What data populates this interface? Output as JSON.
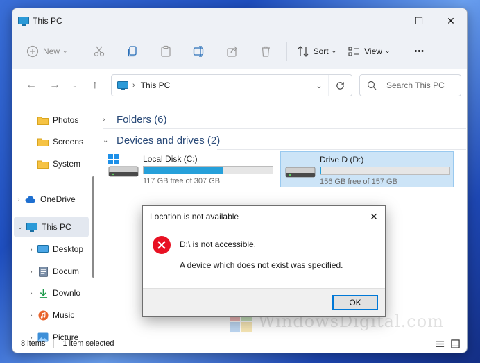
{
  "window": {
    "title": "This PC",
    "controls": {
      "minimize": "—",
      "maximize": "☐",
      "close": "✕"
    }
  },
  "toolbar": {
    "new_label": "New",
    "sort_label": "Sort",
    "view_label": "View",
    "more_label": "•••"
  },
  "address": {
    "path": "This PC",
    "search_placeholder": "Search This PC"
  },
  "sidebar": {
    "items": [
      {
        "label": "Photos"
      },
      {
        "label": "Screens"
      },
      {
        "label": "System"
      },
      {
        "label": "OneDrive"
      },
      {
        "label": "This PC"
      },
      {
        "label": "Desktop"
      },
      {
        "label": "Docum"
      },
      {
        "label": "Downlo"
      },
      {
        "label": "Music"
      },
      {
        "label": "Picture"
      }
    ]
  },
  "main": {
    "folders_header": "Folders (6)",
    "devices_header": "Devices and drives (2)",
    "drives": [
      {
        "name": "Local Disk (C:)",
        "free_text": "117 GB free of 307 GB",
        "used_fraction": 0.62
      },
      {
        "name": "Drive D (D:)",
        "free_text": "156 GB free of 157 GB",
        "used_fraction": 0.006
      }
    ]
  },
  "status": {
    "items_count": "8 items",
    "selection": "1 item selected"
  },
  "dialog": {
    "title": "Location is not available",
    "close": "✕",
    "message": "D:\\ is not accessible.",
    "detail": "A device which does not exist was specified.",
    "ok_label": "OK"
  },
  "watermark": {
    "text": "WindowsDigital.com"
  },
  "colors": {
    "accent": "#0078d7",
    "drive_bar": "#26a0da",
    "error_red": "#e81123",
    "selected_bg": "#cce4f7"
  }
}
